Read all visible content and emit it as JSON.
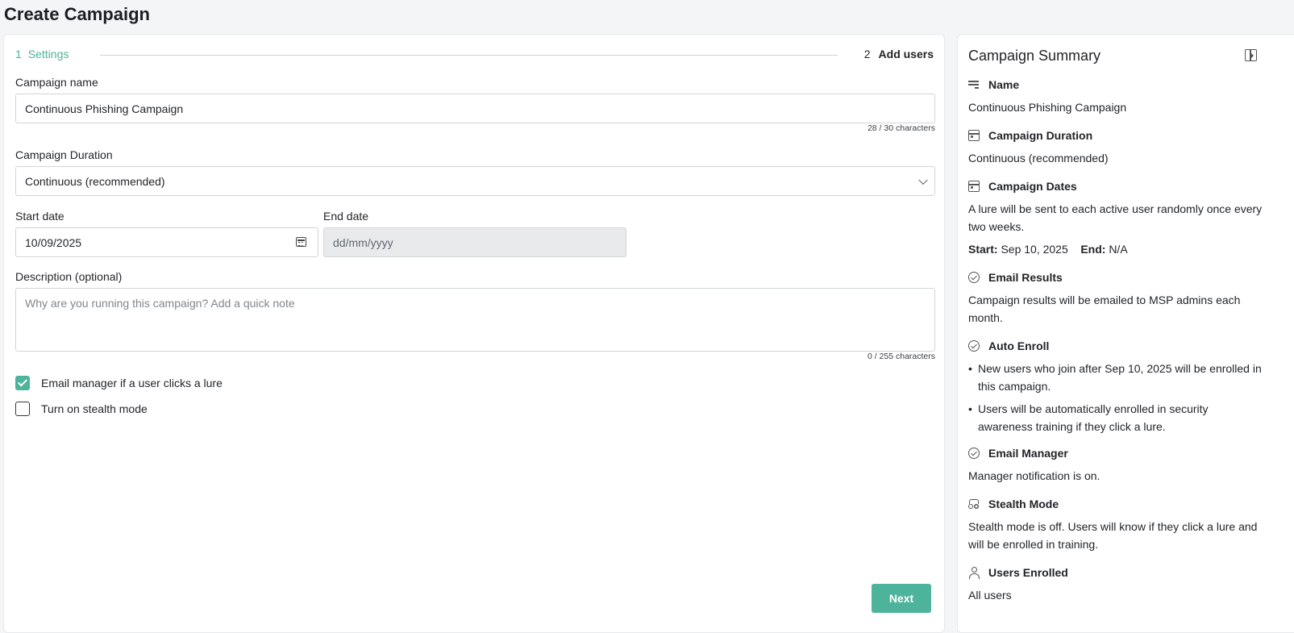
{
  "page": {
    "title": "Create Campaign"
  },
  "stepper": {
    "step1_num": "1",
    "step1_label": "Settings",
    "step2_num": "2",
    "step2_label": "Add users"
  },
  "form": {
    "name_label": "Campaign name",
    "name_value": "Continuous Phishing Campaign",
    "name_counter": "28 / 30 characters",
    "duration_label": "Campaign Duration",
    "duration_value": "Continuous (recommended)",
    "start_label": "Start date",
    "start_value": "10/09/2025",
    "end_label": "End date",
    "end_placeholder": "dd/mm/yyyy",
    "desc_label": "Description (optional)",
    "desc_placeholder": "Why are you running this campaign? Add a quick note",
    "desc_counter": "0 / 255 characters",
    "cb_email_manager": "Email manager if a user clicks a lure",
    "cb_email_manager_checked": true,
    "cb_stealth": "Turn on stealth mode",
    "cb_stealth_checked": false,
    "next_label": "Next"
  },
  "summary": {
    "title": "Campaign Summary",
    "name_head": "Name",
    "name_text": "Continuous Phishing Campaign",
    "duration_head": "Campaign Duration",
    "duration_text": "Continuous (recommended)",
    "dates_head": "Campaign Dates",
    "dates_text": "A lure will be sent to each active user randomly once every two weeks.",
    "start_key": "Start:",
    "start_val": "Sep 10, 2025",
    "end_key": "End:",
    "end_val": "N/A",
    "results_head": "Email Results",
    "results_text": "Campaign results will be emailed to MSP admins each month.",
    "enroll_head": "Auto Enroll",
    "enroll_b1": "New users who join after Sep 10, 2025 will be enrolled in this campaign.",
    "enroll_b2": "Users will be automatically enrolled in security awareness training if they click a lure.",
    "manager_head": "Email Manager",
    "manager_text": "Manager notification is on.",
    "stealth_head": "Stealth Mode",
    "stealth_text": "Stealth mode is off. Users will know if they click a lure and will be enrolled in training.",
    "users_head": "Users Enrolled",
    "users_text": "All users"
  },
  "colors": {
    "accent": "#4db39a"
  }
}
